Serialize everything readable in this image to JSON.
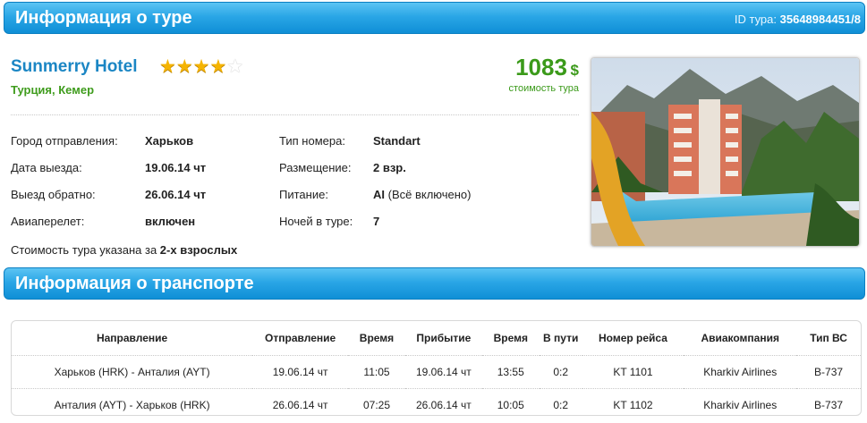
{
  "tour_header": {
    "title": "Информация о туре",
    "id_label": "ID тура:",
    "id_value": "35648984451/8"
  },
  "hotel": {
    "name": "Sunmerry Hotel",
    "stars_filled": 4,
    "stars_total": 5,
    "location": "Турция, Кемер",
    "price": "1083",
    "currency": "$",
    "price_label": "стоимость тура"
  },
  "details_left": [
    {
      "label": "Город отправления:",
      "value": "Харьков"
    },
    {
      "label": "Дата выезда:",
      "value": "19.06.14 чт"
    },
    {
      "label": "Выезд обратно:",
      "value": "26.06.14 чт"
    },
    {
      "label": "Авиаперелет:",
      "value": "включен"
    }
  ],
  "details_right": [
    {
      "label": "Тип номера:",
      "value": "Standart"
    },
    {
      "label": "Размещение:",
      "value": "2 взр."
    },
    {
      "label": "Питание:",
      "value": "AI",
      "value_extra": " (Всё включено)"
    },
    {
      "label": "Ночей в туре:",
      "value": "7"
    }
  ],
  "note": {
    "text": "Стоимость тура указана за ",
    "bold": "2-х взрослых"
  },
  "transport_header": {
    "title": "Информация о транспорте"
  },
  "transport_table": {
    "columns": [
      "Направление",
      "Отправление",
      "Время",
      "Прибытие",
      "Время",
      "В пути",
      "Номер рейса",
      "Авиакомпания",
      "Тип ВС"
    ],
    "rows": [
      [
        "Харьков (HRK) - Анталия (AYT)",
        "19.06.14 чт",
        "11:05",
        "19.06.14 чт",
        "13:55",
        "0:2",
        "KT 1101",
        "Kharkiv Airlines",
        "B-737"
      ],
      [
        "Анталия (AYT) - Харьков (HRK)",
        "26.06.14 чт",
        "07:25",
        "26.06.14 чт",
        "10:05",
        "0:2",
        "KT 1102",
        "Kharkiv Airlines",
        "B-737"
      ]
    ]
  },
  "colors": {
    "header_blue": "#1e9be0",
    "hotel_name": "#1b86c4",
    "green": "#3b9a1a",
    "star": "#f5b400"
  }
}
